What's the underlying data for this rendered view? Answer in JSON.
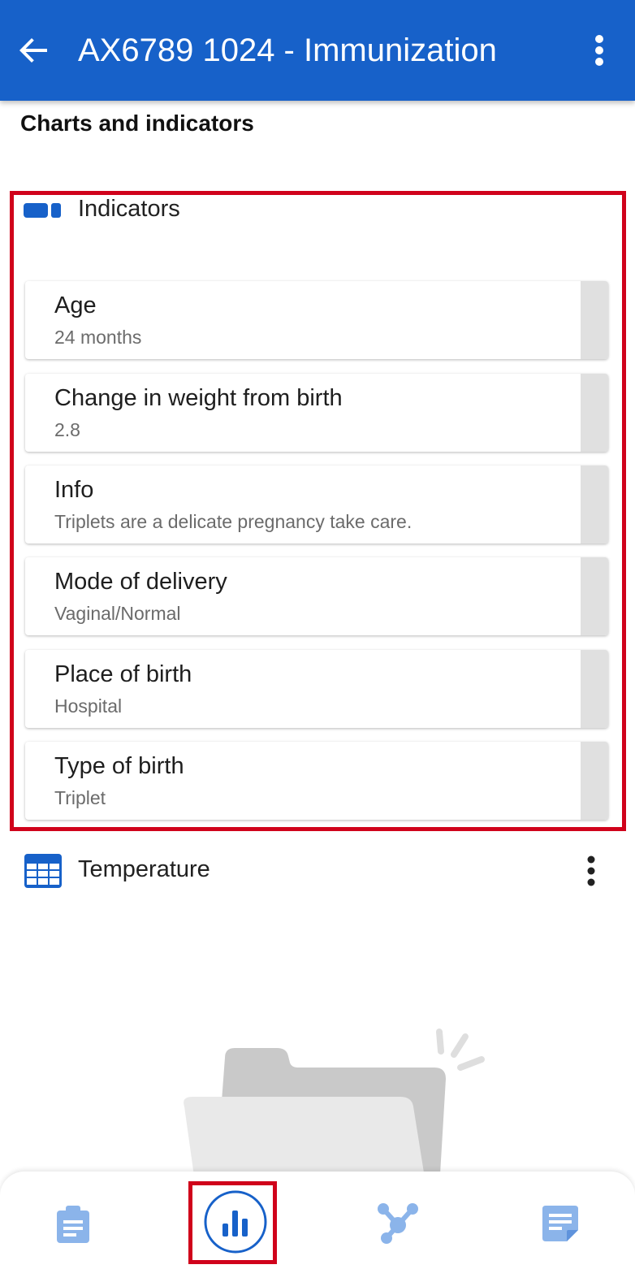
{
  "appbar": {
    "title": "AX6789 1024 - Immunization",
    "back_icon": "arrow-back-icon",
    "more_icon": "more-vert-icon"
  },
  "section_title": "Charts and indicators",
  "indicators": {
    "label": "Indicators",
    "icon": "indicator-icon",
    "items": [
      {
        "name": "Age",
        "value": "24 months"
      },
      {
        "name": "Change in weight from birth",
        "value": "2.8"
      },
      {
        "name": "Info",
        "value": "Triplets are a delicate pregnancy take care."
      },
      {
        "name": "Mode of delivery",
        "value": "Vaginal/Normal"
      },
      {
        "name": "Place of birth",
        "value": "Hospital"
      },
      {
        "name": "Type of birth",
        "value": "Triplet"
      }
    ]
  },
  "temperature": {
    "label": "Temperature",
    "icon": "table-icon",
    "more_icon": "more-vert-icon"
  },
  "bottom_nav": [
    {
      "icon": "clipboard-icon",
      "selected": false
    },
    {
      "icon": "bar-chart-icon",
      "selected": true
    },
    {
      "icon": "relationship-icon",
      "selected": false
    },
    {
      "icon": "notes-icon",
      "selected": false
    }
  ],
  "colors": {
    "primary": "#1761c9",
    "highlight": "#d0021b",
    "nav_inactive": "#8bb4ea"
  }
}
